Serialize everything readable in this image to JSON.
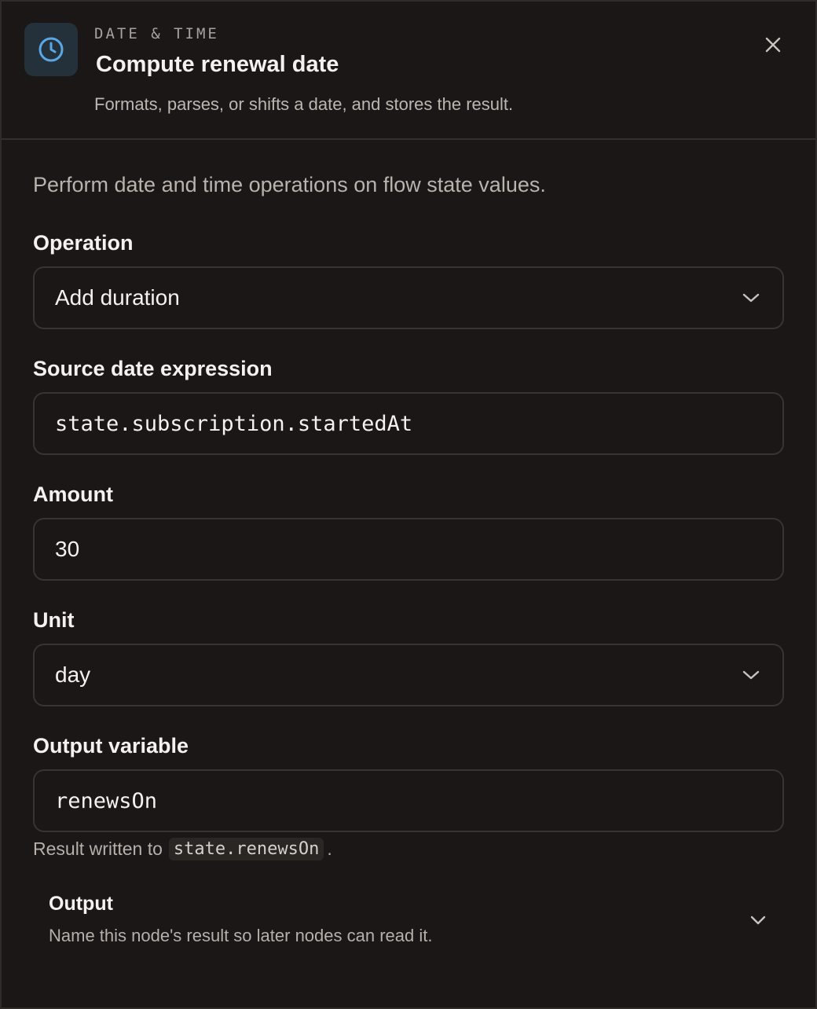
{
  "header": {
    "eyebrow": "DATE & TIME",
    "title": "Compute renewal date",
    "subtitle": "Formats, parses, or shifts a date, and stores the result.",
    "icon": "clock-icon",
    "close_icon": "close-icon"
  },
  "intro": "Perform date and time operations on flow state values.",
  "fields": {
    "operation": {
      "label": "Operation",
      "value": "Add duration"
    },
    "source": {
      "label": "Source date expression",
      "value": "state.subscription.startedAt"
    },
    "amount": {
      "label": "Amount",
      "value": "30"
    },
    "unit": {
      "label": "Unit",
      "value": "day"
    },
    "output_variable": {
      "label": "Output variable",
      "value": "renewsOn"
    }
  },
  "hint": {
    "prefix": "Result written to",
    "code": "state.renewsOn",
    "suffix": "."
  },
  "output_section": {
    "title": "Output",
    "description": "Name this node's result so later nodes can read it."
  },
  "colors": {
    "background": "#1a1716",
    "accent": "#5aa7e6",
    "border": "#39342f"
  }
}
